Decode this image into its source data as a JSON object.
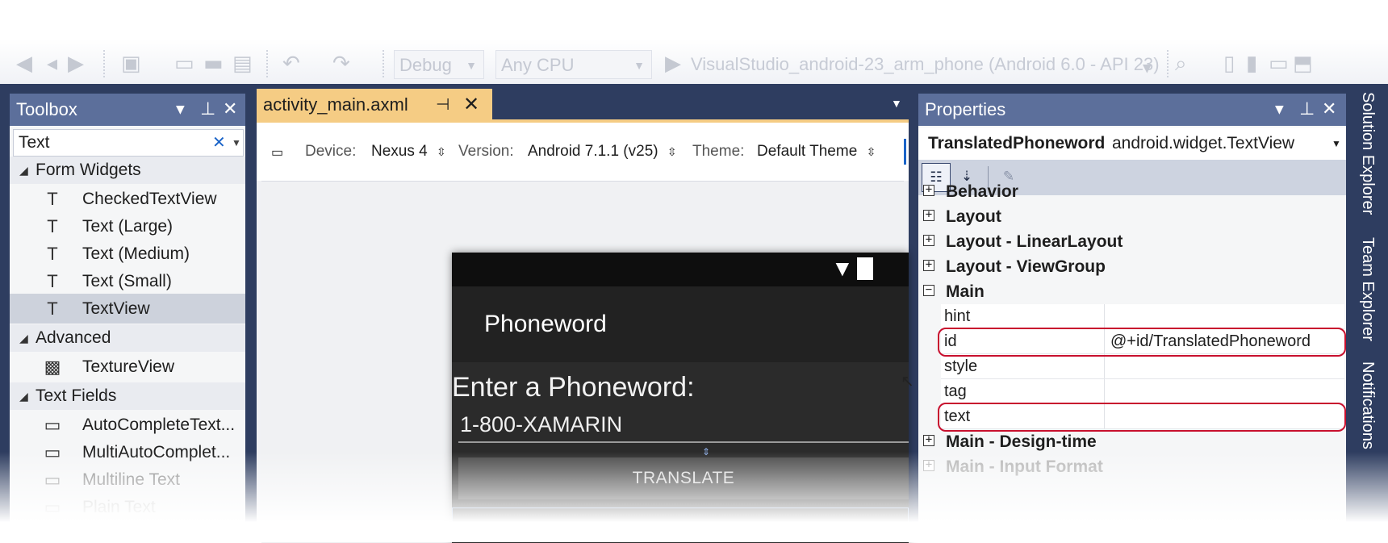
{
  "toolbar": {
    "config": "Debug",
    "platform": "Any CPU",
    "run_target": "VisualStudio_android-23_arm_phone (Android 6.0 - API 23)"
  },
  "toolbox": {
    "title": "Toolbox",
    "search": "Text",
    "categories": [
      {
        "label": "Form Widgets",
        "items": [
          "CheckedTextView",
          "Text (Large)",
          "Text (Medium)",
          "Text (Small)",
          "TextView"
        ]
      },
      {
        "label": "Advanced",
        "items": [
          "TextureView"
        ]
      },
      {
        "label": "Text Fields",
        "items": [
          "AutoCompleteText...",
          "MultiAutoComplet...",
          "Multiline Text",
          "Plain Text"
        ]
      }
    ],
    "selected_item": "TextView"
  },
  "designer": {
    "tab": "activity_main.axml",
    "device_label": "Device:",
    "device": "Nexus 4",
    "version_label": "Version:",
    "version": "Android 7.1.1 (v25)",
    "theme_label": "Theme:",
    "theme": "Default Theme",
    "phone": {
      "app_title": "Phoneword",
      "prompt": "Enter a Phoneword:",
      "input": "1-800-XAMARIN",
      "button": "TRANSLATE"
    }
  },
  "properties": {
    "title": "Properties",
    "object_name": "TranslatedPhoneword",
    "object_type": "android.widget.TextView",
    "categories_top": [
      "Behavior",
      "Layout",
      "Layout - LinearLayout",
      "Layout - ViewGroup",
      "Main"
    ],
    "main_rows": [
      {
        "name": "hint",
        "value": ""
      },
      {
        "name": "id",
        "value": "@+id/TranslatedPhoneword"
      },
      {
        "name": "style",
        "value": ""
      },
      {
        "name": "tag",
        "value": ""
      },
      {
        "name": "text",
        "value": ""
      }
    ],
    "categories_bottom": [
      "Main - Design-time",
      "Main - Input Format"
    ]
  },
  "side_tabs": [
    "Solution Explorer",
    "Team Explorer",
    "Notifications"
  ],
  "colors": {
    "frame": "#2e3d60",
    "panel_title": "#5c6f9b",
    "active_tab": "#f5cc84",
    "highlight": "#c8102e"
  }
}
